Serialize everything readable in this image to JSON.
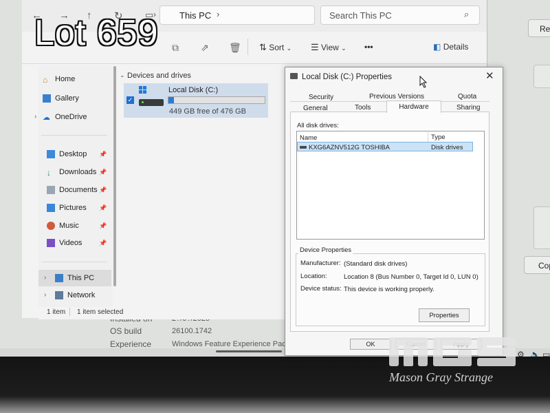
{
  "overlay": {
    "lot_label": "Lot 659",
    "watermark_name": "Mason Gray Strange"
  },
  "background_window": {
    "right_button_1": "Re",
    "right_button_2": "Cop",
    "info_rows": [
      {
        "label": "Installed on",
        "value": "2?/0?/2025"
      },
      {
        "label": "OS build",
        "value": "26100.1742"
      },
      {
        "label": "Experience",
        "value": "Windows Feature Experience Pack"
      }
    ]
  },
  "explorer": {
    "address": {
      "location": "This PC"
    },
    "search_placeholder": "Search This PC",
    "toolbar": {
      "sort_label": "Sort",
      "view_label": "View",
      "more_label": "•••",
      "details_label": "Details"
    },
    "sidebar": {
      "items": [
        {
          "label": "Home",
          "icon": "home-icon"
        },
        {
          "label": "Gallery",
          "icon": "gallery-icon"
        },
        {
          "label": "OneDrive",
          "icon": "onedrive-icon"
        },
        {
          "label": "Desktop",
          "icon": "desktop-icon"
        },
        {
          "label": "Downloads",
          "icon": "downloads-icon"
        },
        {
          "label": "Documents",
          "icon": "documents-icon"
        },
        {
          "label": "Pictures",
          "icon": "pictures-icon"
        },
        {
          "label": "Music",
          "icon": "music-icon"
        },
        {
          "label": "Videos",
          "icon": "videos-icon"
        },
        {
          "label": "This PC",
          "icon": "this-pc-icon"
        },
        {
          "label": "Network",
          "icon": "network-icon"
        }
      ]
    },
    "section_header": "Devices and drives",
    "drive": {
      "name": "Local Disk (C:)",
      "free_text": "449 GB free of 476 GB",
      "used_fraction": 0.057
    },
    "status": {
      "count": "1 item",
      "selected": "1 item selected"
    }
  },
  "dialog": {
    "title": "Local Disk (C:) Properties",
    "tabs_row1": [
      "Security",
      "Previous Versions",
      "Quota"
    ],
    "tabs_row2": [
      "General",
      "Tools",
      "Hardware",
      "Sharing"
    ],
    "active_tab": "Hardware",
    "all_disk_drives_label": "All disk drives:",
    "columns": [
      "Name",
      "Type"
    ],
    "drives": [
      {
        "name": "KXG6AZNV512G TOSHIBA",
        "type": "Disk drives"
      }
    ],
    "device_properties": {
      "heading": "Device Properties",
      "manufacturer_label": "Manufacturer:",
      "manufacturer": "(Standard disk drives)",
      "location_label": "Location:",
      "location": "Location 8 (Bus Number 0, Target Id 0, LUN 0)",
      "status_label": "Device status:",
      "status": "This device is working properly."
    },
    "properties_button": "Properties",
    "ok_button": "OK",
    "cancel_button": "Cancel",
    "apply_button": "Apply"
  },
  "colors": {
    "accent": "#2a7bd6",
    "selection": "#cce2f5"
  }
}
